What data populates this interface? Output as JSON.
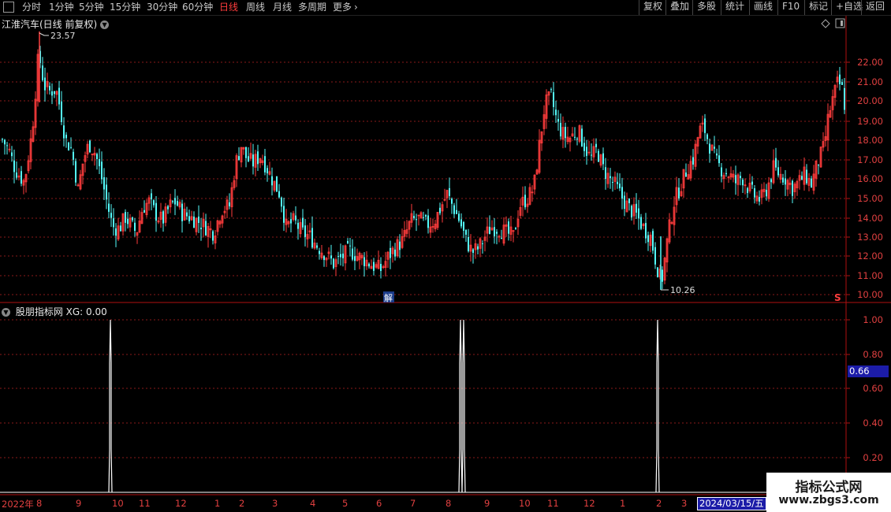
{
  "toolbar": {
    "left_items": [
      "分时",
      "1分钟",
      "5分钟",
      "15分钟",
      "30分钟",
      "60分钟",
      "日线",
      "周线",
      "月线",
      "多周期",
      "更多"
    ],
    "active": "日线",
    "right_items": [
      "复权",
      "叠加",
      "多股",
      "统计",
      "画线",
      "F10",
      "标记",
      "+自选",
      "返回"
    ]
  },
  "main": {
    "title": "江淮汽车(日线 前复权)",
    "high_label": "23.57",
    "low_label": "10.26",
    "unlock_mark": "解",
    "s_mark": "S",
    "y_ticks": [
      "22.00",
      "21.00",
      "20.00",
      "19.00",
      "18.00",
      "17.00",
      "16.00",
      "15.00",
      "14.00",
      "13.00",
      "12.00",
      "11.00",
      "10.00"
    ]
  },
  "indicator": {
    "title": "股朋指标网 XG: 0.00",
    "y_ticks": [
      "1.00",
      "0.80",
      "0.60",
      "0.40",
      "0.20"
    ],
    "cursor_value": "0.66",
    "signal_bars": 3
  },
  "x_axis": {
    "labels": [
      "2022年",
      "8",
      "9",
      "10",
      "11",
      "12",
      "1",
      "2",
      "3",
      "4",
      "5",
      "6",
      "7",
      "8",
      "9",
      "10",
      "11",
      "12",
      "1",
      "2",
      "3"
    ],
    "highlight_date": "2024/03/15/五"
  },
  "watermark": {
    "line1": "指标公式网",
    "line2": "www.zbgs3.com"
  },
  "colors": {
    "up": "#ff3d3d",
    "down": "#54fcfc",
    "grid": "#8a1a1a",
    "axis": "#b01010",
    "signal": "#ffffff"
  }
}
